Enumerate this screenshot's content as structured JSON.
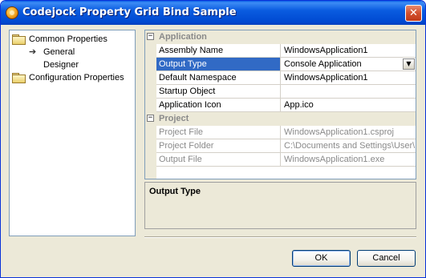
{
  "window": {
    "title": "Codejock Property Grid Bind Sample",
    "close_label": "✕"
  },
  "tree": {
    "items": [
      {
        "label": "Common Properties",
        "icon": "folder-icon",
        "level": 0
      },
      {
        "label": "General",
        "icon": "arrow-icon",
        "level": 1
      },
      {
        "label": "Designer",
        "icon": "",
        "level": 1
      },
      {
        "label": "Configuration Properties",
        "icon": "folder-icon",
        "level": 0
      }
    ],
    "arrow_glyph": "➔"
  },
  "grid": {
    "categories": [
      {
        "name": "Application",
        "toggle": "−",
        "properties": [
          {
            "name": "Assembly Name",
            "value": "WindowsApplication1"
          },
          {
            "name": "Output Type",
            "value": "Console Application"
          },
          {
            "name": "Default Namespace",
            "value": "WindowsApplication1"
          },
          {
            "name": "Startup Object",
            "value": ""
          },
          {
            "name": "Application Icon",
            "value": "App.ico"
          }
        ]
      },
      {
        "name": "Project",
        "toggle": "−",
        "properties": [
          {
            "name": "Project File",
            "value": "WindowsApplication1.csproj"
          },
          {
            "name": "Project Folder",
            "value": "C:\\Documents and Settings\\User\\M"
          },
          {
            "name": "Output File",
            "value": "WindowsApplication1.exe"
          }
        ]
      }
    ],
    "combo_glyph": "▼"
  },
  "help": {
    "title": "Output Type"
  },
  "buttons": {
    "ok_label": "OK",
    "cancel_label": "Cancel"
  },
  "colors": {
    "title_bar": "#0a5ce0",
    "selection": "#316ac5",
    "dialog_bg": "#ece9d8"
  }
}
